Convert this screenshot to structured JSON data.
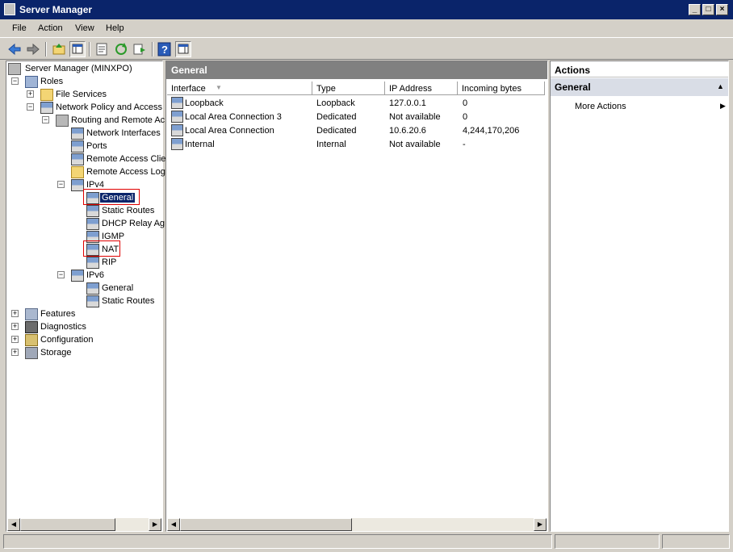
{
  "window": {
    "title": "Server Manager"
  },
  "menu": {
    "items": [
      "File",
      "Action",
      "View",
      "Help"
    ]
  },
  "tree": {
    "root": "Server Manager (MINXPO)",
    "roles": "Roles",
    "file_services": "File Services",
    "npas": "Network Policy and Access",
    "rras": "Routing and Remote Ac",
    "network_interfaces": "Network Interfaces",
    "ports": "Ports",
    "remote_access_clients": "Remote Access Clie",
    "remote_access_logging": "Remote Access Log",
    "ipv4": "IPv4",
    "ipv4_general": "General",
    "ipv4_static_routes": "Static Routes",
    "ipv4_dhcp_relay": "DHCP Relay Ag",
    "ipv4_igmp": "IGMP",
    "ipv4_nat": "NAT",
    "ipv4_rip": "RIP",
    "ipv6": "IPv6",
    "ipv6_general": "General",
    "ipv6_static_routes": "Static Routes",
    "features": "Features",
    "diagnostics": "Diagnostics",
    "configuration": "Configuration",
    "storage": "Storage"
  },
  "main": {
    "header": "General",
    "columns": [
      "Interface",
      "Type",
      "IP Address",
      "Incoming bytes"
    ],
    "rows": [
      {
        "interface": "Loopback",
        "type": "Loopback",
        "ip": "127.0.0.1",
        "incoming": "0"
      },
      {
        "interface": "Local Area Connection 3",
        "type": "Dedicated",
        "ip": "Not available",
        "incoming": "0"
      },
      {
        "interface": "Local Area Connection",
        "type": "Dedicated",
        "ip": "10.6.20.6",
        "incoming": "4,244,170,206"
      },
      {
        "interface": "Internal",
        "type": "Internal",
        "ip": "Not available",
        "incoming": "-"
      }
    ]
  },
  "actions": {
    "title": "Actions",
    "section": "General",
    "more_actions": "More Actions"
  }
}
